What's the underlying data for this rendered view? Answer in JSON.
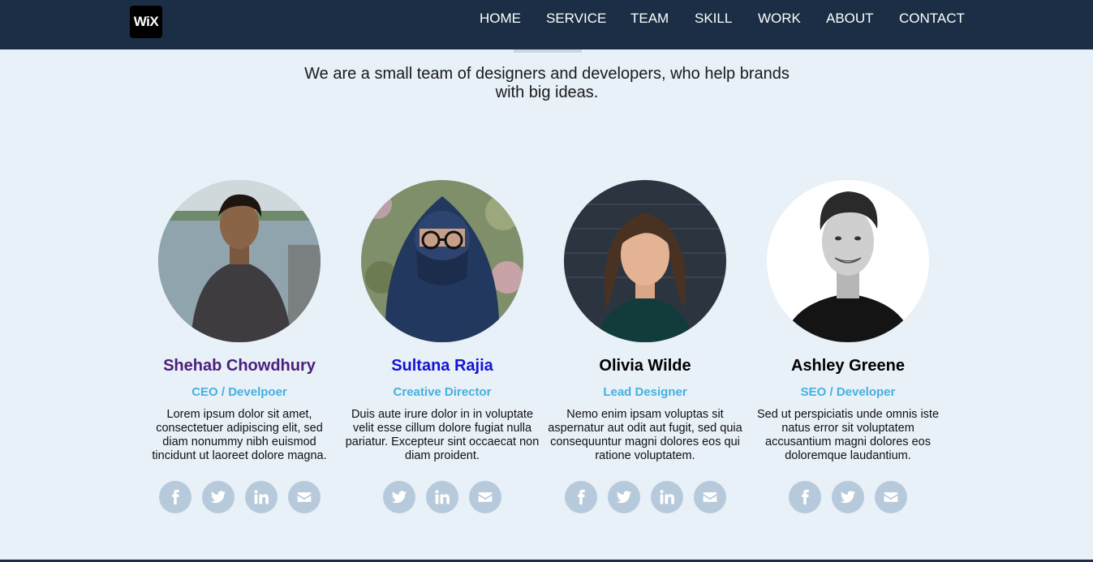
{
  "brand": {
    "logo_text": "WiX"
  },
  "nav": {
    "items": [
      "HOME",
      "SERVICE",
      "TEAM",
      "SKILL",
      "WORK",
      "ABOUT",
      "CONTACT"
    ]
  },
  "intro": {
    "text": "We are a small team of designers and developers, who help brands with big ideas."
  },
  "team": [
    {
      "name": "Shehab Chowdhury",
      "name_color": "#4a1f7a",
      "role": "CEO / Develpoer",
      "bio": "Lorem ipsum dolor sit amet, consectetuer adipiscing elit, sed diam nonummy nibh euismod tincidunt ut laoreet dolore magna.",
      "socials": [
        "facebook-icon",
        "twitter-icon",
        "linkedin-icon",
        "envelope-icon"
      ]
    },
    {
      "name": "Sultana Rajia",
      "name_color": "#1414d4",
      "role": "Creative Director",
      "bio": "Duis aute irure dolor in in voluptate velit esse cillum dolore fugiat nulla pariatur. Excepteur sint occaecat non diam proident.",
      "socials": [
        "twitter-icon",
        "linkedin-icon",
        "envelope-icon"
      ]
    },
    {
      "name": "Olivia Wilde",
      "name_color": "#000000",
      "role": "Lead Designer",
      "bio": "Nemo enim ipsam voluptas sit aspernatur aut odit aut fugit, sed quia consequuntur magni dolores eos qui ratione voluptatem.",
      "socials": [
        "facebook-icon",
        "twitter-icon",
        "linkedin-icon",
        "envelope-icon"
      ]
    },
    {
      "name": "Ashley Greene",
      "name_color": "#000000",
      "role": "SEO / Developer",
      "bio": "Sed ut perspiciatis unde omnis iste natus error sit voluptatem accusantium magni dolores eos doloremque laudantium.",
      "socials": [
        "facebook-icon",
        "twitter-icon",
        "envelope-icon"
      ]
    }
  ],
  "colors": {
    "navbar_bg": "#1b2e45",
    "page_bg": "#e8f0f8",
    "role_text": "#45b1de",
    "social_bg": "#b7cadb"
  }
}
